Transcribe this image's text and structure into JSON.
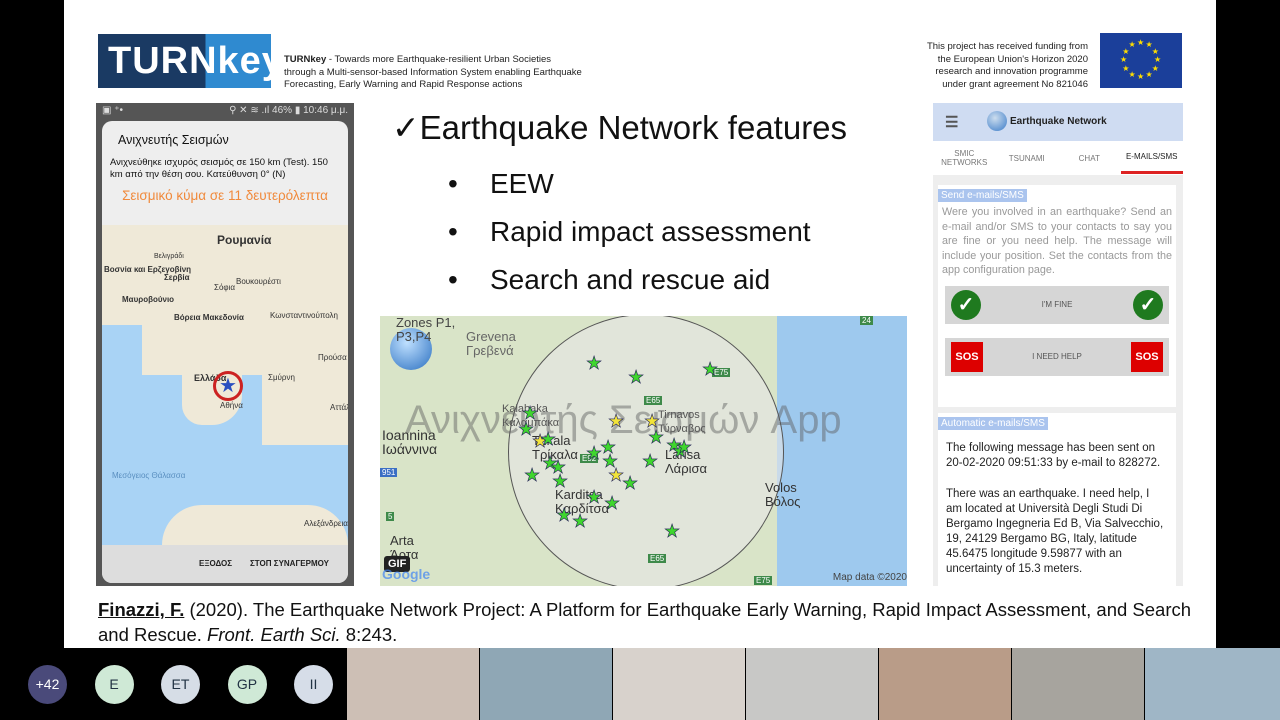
{
  "header": {
    "logo_text": "TURNkey",
    "project_name": "TURNkey",
    "project_desc": " - Towards more Earthquake-resilient Urban Societies through a Multi-sensor-based Information System enabling Earthquake Forecasting, Early Warning and Rapid Response actions",
    "funding": "This project has received funding from the European Union's Horizon 2020 research and innovation programme under grant agreement No 821046"
  },
  "phone": {
    "status_left": "▣ ⁺•",
    "status_right": "⚲ ✕ ≋ .ıl 46% ▮ 10:46 μ.μ.",
    "dialog_title": "Ανιχνευτής Σεισμών",
    "message": "Ανιχνεύθηκε ισχυρός σεισμός σε 150 km (Test). 150 km από την θέση σου. Κατεύθυνση 0° (N)",
    "wave_text": "Σεισμικό κύμα σε 11 δευτερόλεπτα",
    "map_labels": [
      "Ρουμανία",
      "Βελιγράδι",
      "Βοσνία και Ερζεγοβίνη",
      "Σερβία",
      "Σόφια",
      "Βουκουρέστι",
      "Μαυροβούνιο",
      "Βόρεια Μακεδονία",
      "Κωνσταντινούπολη",
      "Ελλάδα",
      "Αθήνα",
      "Σμύρνη",
      "Προύσα",
      "Αττάλεια",
      "Μεσόγειος Θάλασσα",
      "Αλεξάνδρεια"
    ],
    "exit": "ΕΞΟΔΟΣ",
    "stop_alarm": "ΣΤΟΠ ΣΥΝΑΓΕΡΜΟΥ"
  },
  "main": {
    "heading": "✓Earthquake Network features",
    "bullets": [
      "EEW",
      "Rapid impact assessment",
      "Search and rescue aid"
    ]
  },
  "eqmap": {
    "watermark": "Ανιχνευτής Σεισμών App",
    "labels": [
      "Zones P1, P3,P4",
      "Grevena Γρεβενά",
      "Ioannina Ιωάννινα",
      "Kalabaka Καλαμπάκα",
      "Trikala Τρίκαλα",
      "Tirnavos Τύρναβος",
      "Larisa Λάρισα",
      "Karditsa Καρδίτσα",
      "Volos Βόλος",
      "Arta Άρτα"
    ],
    "road_labels": [
      "E65",
      "E75",
      "E92",
      "24",
      "951",
      "5"
    ],
    "gif": "GIF",
    "google": "Google",
    "map_data": "Map data ©2020",
    "colors": {
      "felt": "#3fd62e",
      "other": "#f2e43a"
    }
  },
  "app": {
    "title": "Earthquake Network",
    "tabs": [
      "SMIC NETWORKS",
      "TSUNAMI",
      "CHAT",
      "E-MAILS/SMS"
    ],
    "send_title": "Send e-mails/SMS",
    "send_text": "Were you involved in an earthquake? Send an e-mail and/or SMS to your contacts to say you are fine or you need help. The message will include your position. Set the contacts from the app configuration page.",
    "fine": "I'M FINE",
    "help": "I NEED HELP",
    "sos": "SOS",
    "auto_title": "Automatic e-mails/SMS",
    "auto_msg1": "The following message has been sent on 20-02-2020 09:51:33 by e-mail to 828272.",
    "auto_msg2": "There was an earthquake. I need help, I am located at Università Degli Studi Di Bergamo Ingegneria Ed B, Via Salvecchio, 19, 24129 Bergamo BG, Italy, latitude 45.6475 longitude 9.59877 with an uncertainty of 15.3 meters."
  },
  "citation": {
    "author": "Finazzi, F.",
    "rest": " (2020). The Earthquake Network Project: A Platform for Earthquake Early Warning, Rapid Impact Assessment, and Search and Rescue. ",
    "journal": "Front. Earth Sci.",
    "vol": " 8:243."
  },
  "meeting": {
    "participants": [
      {
        "initials": "+42",
        "color": "#4a4a7a"
      },
      {
        "initials": "E",
        "color": "#cfe9d6"
      },
      {
        "initials": "ET",
        "color": "#d6dde6"
      },
      {
        "initials": "GP",
        "color": "#cfe9d6"
      },
      {
        "initials": "II",
        "color": "#d6dde8"
      }
    ]
  }
}
